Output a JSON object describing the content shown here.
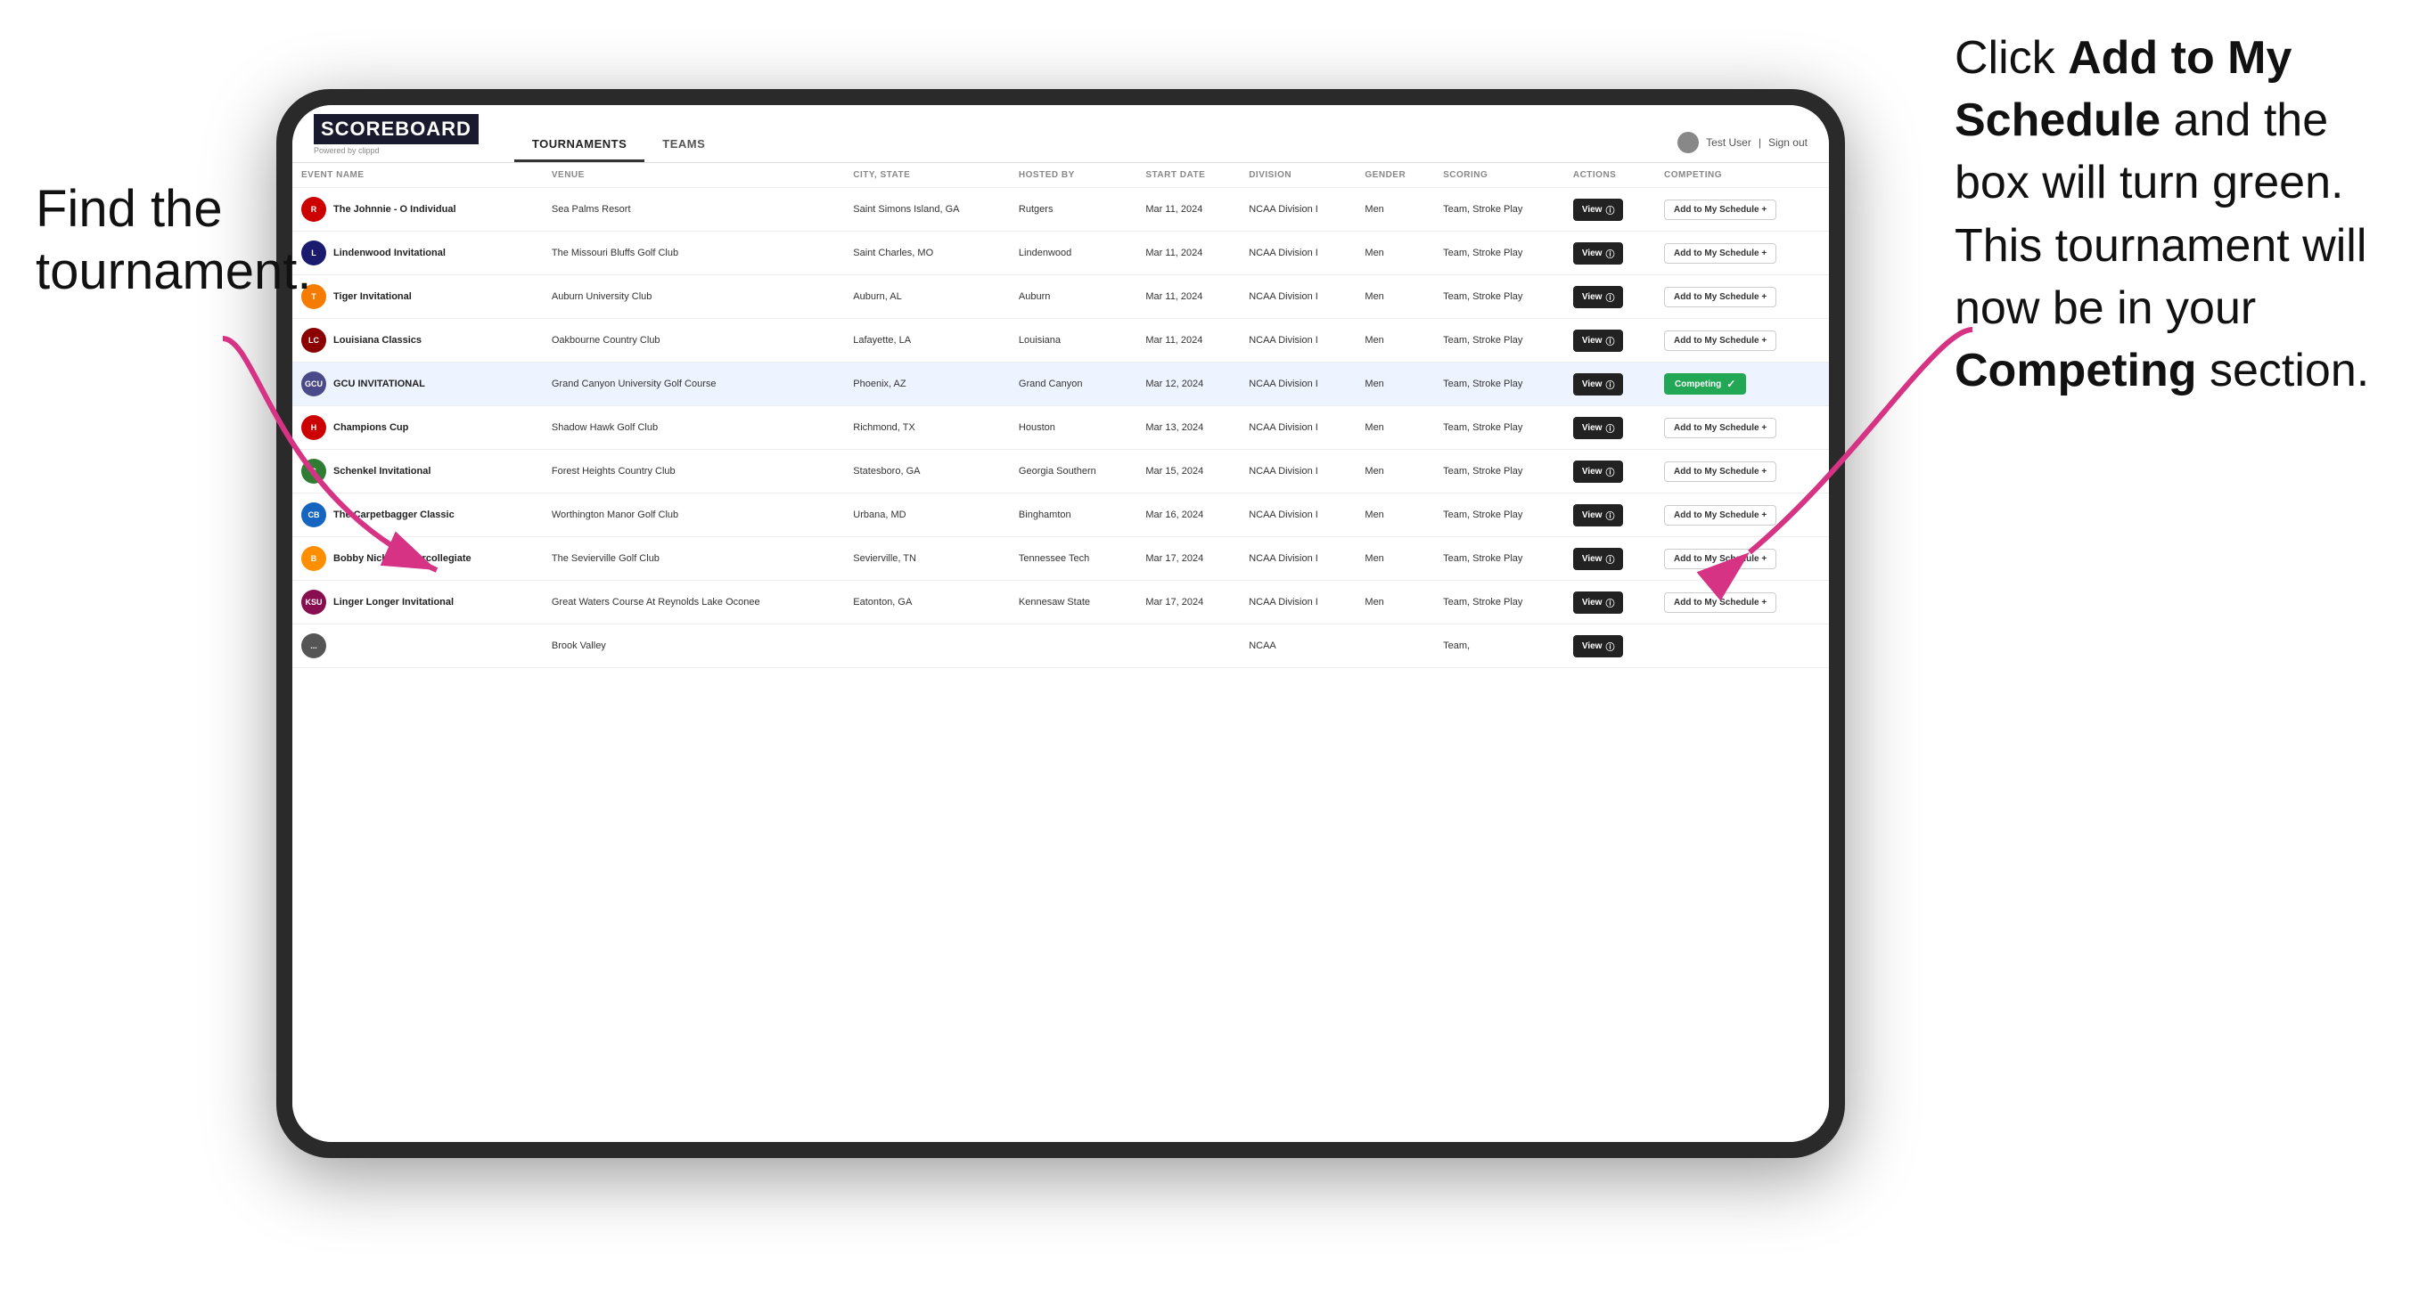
{
  "annotations": {
    "left": "Find the\ntournament.",
    "right_line1": "Click ",
    "right_bold1": "Add to My\nSchedule",
    "right_line2": " and the\nbox will turn green.\nThis tournament\nwill now be in\nyour ",
    "right_bold2": "Competing",
    "right_line3": "\nsection."
  },
  "header": {
    "logo": "SCOREBOARD",
    "powered_by": "Powered by clippd",
    "nav_tabs": [
      "TOURNAMENTS",
      "TEAMS"
    ],
    "active_tab": "TOURNAMENTS",
    "user": "Test User",
    "signout": "Sign out"
  },
  "table": {
    "columns": [
      "EVENT NAME",
      "VENUE",
      "CITY, STATE",
      "HOSTED BY",
      "START DATE",
      "DIVISION",
      "GENDER",
      "SCORING",
      "ACTIONS",
      "COMPETING"
    ],
    "rows": [
      {
        "logo_color": "#cc0000",
        "logo_text": "R",
        "event_name": "The Johnnie - O Individual",
        "venue": "Sea Palms Resort",
        "city_state": "Saint Simons Island, GA",
        "hosted_by": "Rutgers",
        "start_date": "Mar 11, 2024",
        "division": "NCAA Division I",
        "gender": "Men",
        "scoring": "Team, Stroke Play",
        "action": "View",
        "competing": "Add to My Schedule +",
        "competing_type": "add",
        "highlighted": false
      },
      {
        "logo_color": "#1a1a6e",
        "logo_text": "L",
        "event_name": "Lindenwood Invitational",
        "venue": "The Missouri Bluffs Golf Club",
        "city_state": "Saint Charles, MO",
        "hosted_by": "Lindenwood",
        "start_date": "Mar 11, 2024",
        "division": "NCAA Division I",
        "gender": "Men",
        "scoring": "Team, Stroke Play",
        "action": "View",
        "competing": "Add to My Schedule +",
        "competing_type": "add",
        "highlighted": false
      },
      {
        "logo_color": "#f57c00",
        "logo_text": "T",
        "event_name": "Tiger Invitational",
        "venue": "Auburn University Club",
        "city_state": "Auburn, AL",
        "hosted_by": "Auburn",
        "start_date": "Mar 11, 2024",
        "division": "NCAA Division I",
        "gender": "Men",
        "scoring": "Team, Stroke Play",
        "action": "View",
        "competing": "Add to My Schedule +",
        "competing_type": "add",
        "highlighted": false
      },
      {
        "logo_color": "#8b0000",
        "logo_text": "LC",
        "event_name": "Louisiana Classics",
        "venue": "Oakbourne Country Club",
        "city_state": "Lafayette, LA",
        "hosted_by": "Louisiana",
        "start_date": "Mar 11, 2024",
        "division": "NCAA Division I",
        "gender": "Men",
        "scoring": "Team, Stroke Play",
        "action": "View",
        "competing": "Add to My Schedule +",
        "competing_type": "add",
        "highlighted": false
      },
      {
        "logo_color": "#4a4a8a",
        "logo_text": "GCU",
        "event_name": "GCU INVITATIONAL",
        "venue": "Grand Canyon University Golf Course",
        "city_state": "Phoenix, AZ",
        "hosted_by": "Grand Canyon",
        "start_date": "Mar 12, 2024",
        "division": "NCAA Division I",
        "gender": "Men",
        "scoring": "Team, Stroke Play",
        "action": "View",
        "competing": "Competing",
        "competing_type": "competing",
        "highlighted": true
      },
      {
        "logo_color": "#cc0000",
        "logo_text": "H",
        "event_name": "Champions Cup",
        "venue": "Shadow Hawk Golf Club",
        "city_state": "Richmond, TX",
        "hosted_by": "Houston",
        "start_date": "Mar 13, 2024",
        "division": "NCAA Division I",
        "gender": "Men",
        "scoring": "Team, Stroke Play",
        "action": "View",
        "competing": "Add to My Schedule +",
        "competing_type": "add",
        "highlighted": false
      },
      {
        "logo_color": "#2e7d32",
        "logo_text": "S",
        "event_name": "Schenkel Invitational",
        "venue": "Forest Heights Country Club",
        "city_state": "Statesboro, GA",
        "hosted_by": "Georgia Southern",
        "start_date": "Mar 15, 2024",
        "division": "NCAA Division I",
        "gender": "Men",
        "scoring": "Team, Stroke Play",
        "action": "View",
        "competing": "Add to My Schedule +",
        "competing_type": "add",
        "highlighted": false
      },
      {
        "logo_color": "#1565c0",
        "logo_text": "CB",
        "event_name": "The Carpetbagger Classic",
        "venue": "Worthington Manor Golf Club",
        "city_state": "Urbana, MD",
        "hosted_by": "Binghamton",
        "start_date": "Mar 16, 2024",
        "division": "NCAA Division I",
        "gender": "Men",
        "scoring": "Team, Stroke Play",
        "action": "View",
        "competing": "Add to My Schedule +",
        "competing_type": "add",
        "highlighted": false
      },
      {
        "logo_color": "#ff8f00",
        "logo_text": "B",
        "event_name": "Bobby Nichols Intercollegiate",
        "venue": "The Sevierville Golf Club",
        "city_state": "Sevierville, TN",
        "hosted_by": "Tennessee Tech",
        "start_date": "Mar 17, 2024",
        "division": "NCAA Division I",
        "gender": "Men",
        "scoring": "Team, Stroke Play",
        "action": "View",
        "competing": "Add to My Schedule +",
        "competing_type": "add",
        "highlighted": false
      },
      {
        "logo_color": "#880e4f",
        "logo_text": "KSU",
        "event_name": "Linger Longer Invitational",
        "venue": "Great Waters Course At Reynolds Lake Oconee",
        "city_state": "Eatonton, GA",
        "hosted_by": "Kennesaw State",
        "start_date": "Mar 17, 2024",
        "division": "NCAA Division I",
        "gender": "Men",
        "scoring": "Team, Stroke Play",
        "action": "View",
        "competing": "Add to My Schedule +",
        "competing_type": "add",
        "highlighted": false
      },
      {
        "logo_color": "#555",
        "logo_text": "...",
        "event_name": "",
        "venue": "Brook Valley",
        "city_state": "",
        "hosted_by": "",
        "start_date": "",
        "division": "NCAA",
        "gender": "",
        "scoring": "Team,",
        "action": "View",
        "competing": "",
        "competing_type": "add",
        "highlighted": false
      }
    ]
  }
}
